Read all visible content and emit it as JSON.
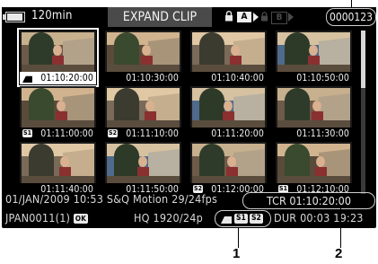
{
  "status_bar": {
    "remaining_time": "120min",
    "screen_title": "EXPAND CLIP",
    "slot_a": "A",
    "slot_b": "B",
    "clip_number": "0000123"
  },
  "thumbnails": [
    {
      "timecode": "01:10:20:00",
      "selected": true,
      "mark": "clip"
    },
    {
      "timecode": "01:10:30:00",
      "selected": false,
      "mark": ""
    },
    {
      "timecode": "01:10:40:00",
      "selected": false,
      "mark": ""
    },
    {
      "timecode": "01:10:50:00",
      "selected": false,
      "mark": ""
    },
    {
      "timecode": "01:11:00:00",
      "selected": false,
      "mark": "S1"
    },
    {
      "timecode": "01:11:10:00",
      "selected": false,
      "mark": "S2"
    },
    {
      "timecode": "01:11:20:00",
      "selected": false,
      "mark": ""
    },
    {
      "timecode": "01:11:30:00",
      "selected": false,
      "mark": ""
    },
    {
      "timecode": "01:11:40:00",
      "selected": false,
      "mark": ""
    },
    {
      "timecode": "01:11:50:00",
      "selected": false,
      "mark": ""
    },
    {
      "timecode": "01:12:00:00",
      "selected": false,
      "mark": "S2"
    },
    {
      "timecode": "01:12:10:00",
      "selected": false,
      "mark": "S1"
    }
  ],
  "info": {
    "date": "01/JAN/2009",
    "time": "10:53",
    "mode": "S&Q Motion 29/24fps",
    "tcr": "TCR 01:10:20:00",
    "clip_name": "JPAN0011(1)",
    "ok": "OK",
    "format": "HQ 1920/24p",
    "mark_s1": "S1",
    "mark_s2": "S2",
    "duration": "DUR 00:03 19:23"
  },
  "callouts": {
    "one": "1",
    "two": "2"
  },
  "colors": {
    "screen_bg": "#000000",
    "title_bg": "#4a4a4a",
    "text": "#d8d8d8"
  }
}
